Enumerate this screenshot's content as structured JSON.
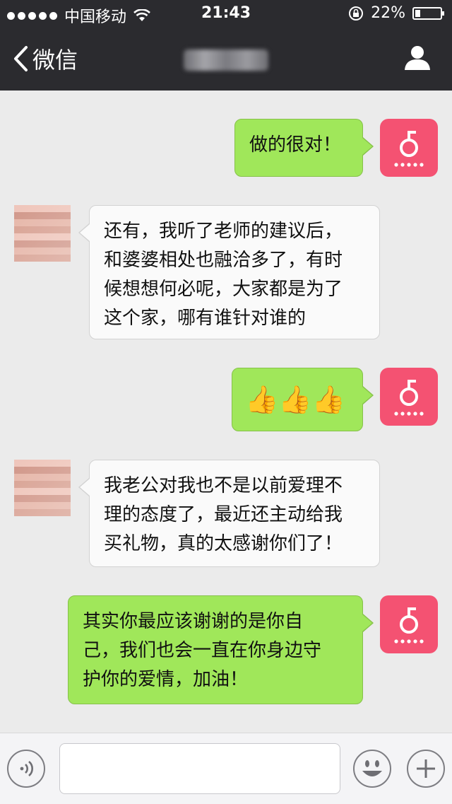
{
  "status_bar": {
    "carrier": "中国移动",
    "time": "21:43",
    "battery": "22%",
    "battery_level": 0.22
  },
  "nav": {
    "back_label": "微信"
  },
  "messages": [
    {
      "from": "me",
      "text": "做的很对！"
    },
    {
      "from": "other",
      "lines": [
        "还有，我听了老师的建议后，",
        "和婆婆相处也融洽多了，有时",
        "候想想何必呢，大家都是为了",
        "这个家，哪有谁针对谁的"
      ]
    },
    {
      "from": "me",
      "emoji": "👍👍👍"
    },
    {
      "from": "other",
      "lines": [
        "我老公对我也不是以前爱理不",
        "理的态度了，最近还主动给我",
        "买礼物，真的太感谢你们了！"
      ]
    },
    {
      "from": "me",
      "lines": [
        "其实你最应该谢谢的是你自",
        "己，我们也会一直在你身边守",
        "护你的爱情，加油！"
      ]
    }
  ],
  "colors": {
    "bar_bg": "#2b2b2f",
    "outgoing_bubble": "#a0e75a",
    "incoming_bubble": "#fafafa",
    "brand_avatar": "#f45272"
  },
  "icons": [
    "signal-dots-icon",
    "wifi-icon",
    "rotation-lock-icon",
    "battery-icon",
    "back-chevron-icon",
    "profile-icon",
    "brand-logo-icon",
    "voice-icon",
    "emoji-icon",
    "plus-icon"
  ]
}
